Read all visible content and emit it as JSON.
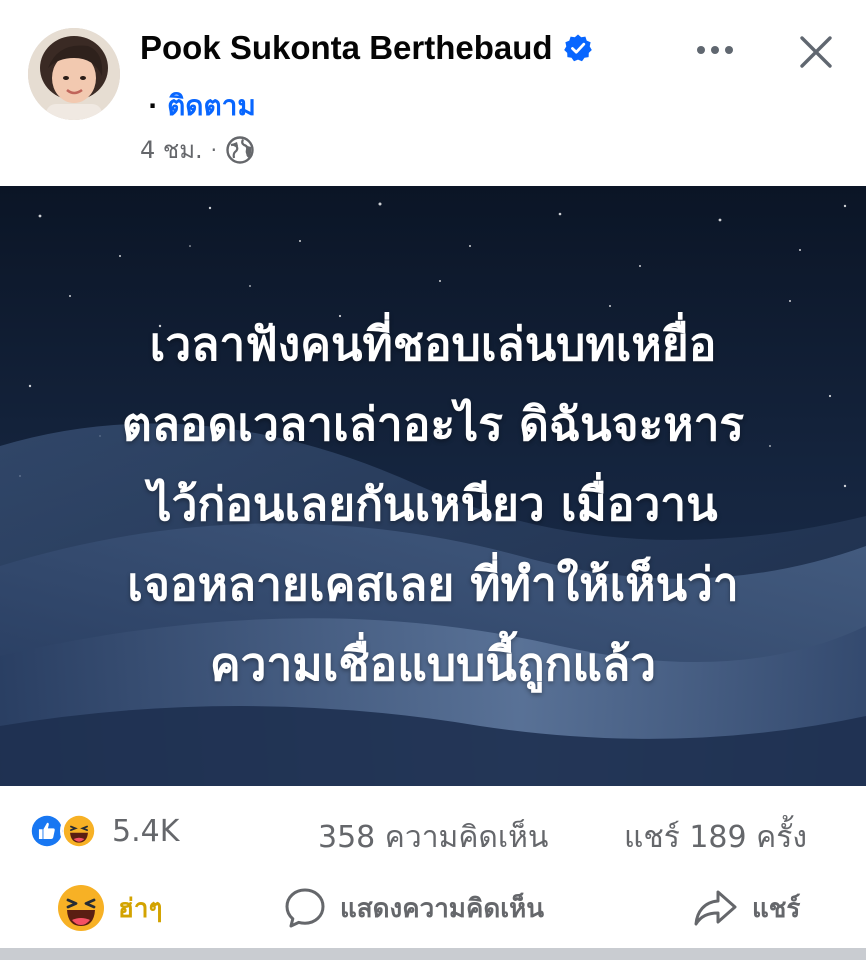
{
  "post": {
    "author_name": "Pook Sukonta Berthebaud",
    "follow_separator": "·",
    "follow_label": "ติดตาม",
    "time": "4 ชม.",
    "meta_separator": "·",
    "icons": {
      "verified": "verified-badge-icon",
      "privacy": "globe-icon",
      "more": "more-options-icon",
      "close": "close-icon"
    },
    "body_lines": [
      "เวลาฟังคนที่ชอบเล่นบทเหยื่อ",
      "ตลอดเวลาเล่าอะไร ดิฉันจะหาร",
      "ไว้ก่อนเลยกันเหนียว เมื่อวาน",
      "เจอหลายเคสเลย ที่ทำให้เห็นว่า",
      "ความเชื่อแบบนี้ถูกแล้ว"
    ]
  },
  "stats": {
    "reaction_icons": [
      "like-reaction-icon",
      "haha-reaction-icon"
    ],
    "reactions_count": "5.4K",
    "comments": "358 ความคิดเห็น",
    "shares": "แชร์ 189 ครั้ง"
  },
  "actions": {
    "react_label": "ฮ่าๆ",
    "comment_label": "แสดงความคิดเห็น",
    "share_label": "แชร์"
  },
  "colors": {
    "accent_blue": "#0866ff",
    "secondary_text": "#65676b",
    "haha_yellow": "#f7b125",
    "background_night": "#14233d"
  }
}
